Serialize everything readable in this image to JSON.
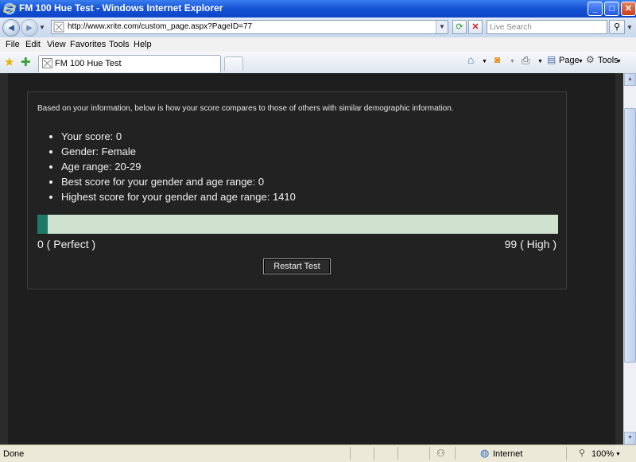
{
  "window": {
    "title": "FM 100 Hue Test - Windows Internet Explorer",
    "controls": {
      "minimize": "_",
      "maximize": "□",
      "close": "✕"
    }
  },
  "address_bar": {
    "url": "http://www.xrite.com/custom_page.aspx?PageID=77",
    "search_placeholder": "Live Search"
  },
  "menu": [
    "File",
    "Edit",
    "View",
    "Favorites",
    "Tools",
    "Help"
  ],
  "tabs": [
    {
      "label": "FM 100 Hue Test",
      "active": true
    }
  ],
  "command_bar": {
    "page_label": "Page",
    "tools_label": "Tools"
  },
  "page": {
    "intro": "Based on your information, below is how your score compares to those of others with similar demographic information.",
    "results": [
      "Your score: 0",
      "Gender: Female",
      "Age range: 20-29",
      "Best score for your gender and age range: 0",
      "Highest score for your gender and age range: 1410"
    ],
    "score_bar": {
      "low_label": "0 ( Perfect )",
      "high_label": "99 ( High )",
      "value_fraction": 0.02,
      "fill_color": "#1d7a64",
      "track_color": "#cfe1cf"
    },
    "restart_button": "Restart Test"
  },
  "status_bar": {
    "status": "Done",
    "zone": "Internet",
    "zoom": "100%"
  },
  "colors": {
    "titlebar": "#1552d4",
    "page_background": "#1e1e1e",
    "text": "#f0f0f0"
  }
}
